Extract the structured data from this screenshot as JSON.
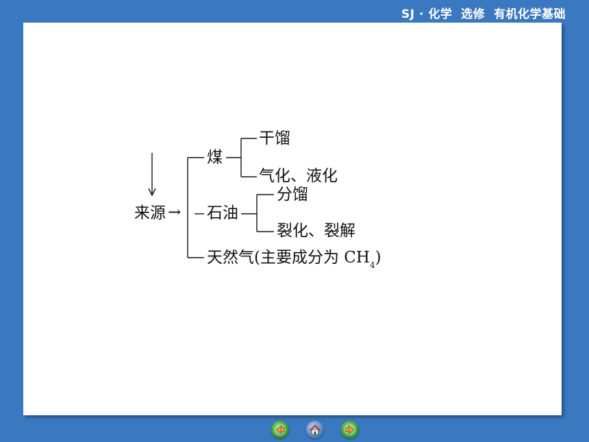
{
  "header": {
    "title": "SJ · 化学  选修  有机化学基础"
  },
  "diagram": {
    "root": "来源",
    "arrow": "→",
    "branches": {
      "coal": {
        "label": "煤",
        "children": [
          "干馏",
          "气化、液化"
        ]
      },
      "petroleum": {
        "label": "石油",
        "children": [
          "分馏",
          "裂化、裂解"
        ]
      },
      "natural_gas": {
        "label_main": "天然气(主要成分为 CH",
        "label_sub": "4",
        "label_end": ")"
      }
    }
  },
  "nav": {
    "prev_icon": "back-arrow-icon",
    "home_icon": "home-icon",
    "next_icon": "forward-arrow-icon"
  }
}
